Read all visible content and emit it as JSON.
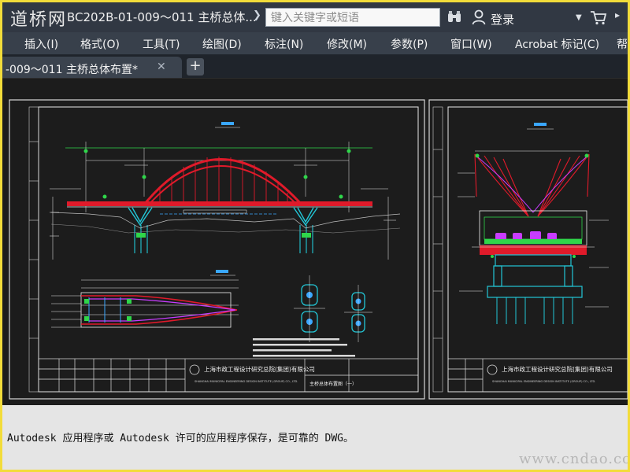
{
  "window": {
    "logo_text": "道桥网",
    "document_title": "BC202B-01-009～011 主桥总体...",
    "search_placeholder": "键入关键字或短语",
    "login_label": "登录"
  },
  "menu": {
    "items": [
      "插入(I)",
      "格式(O)",
      "工具(T)",
      "绘图(D)",
      "标注(N)",
      "修改(M)",
      "参数(P)",
      "窗口(W)",
      "Acrobat 标记(C)",
      "帮"
    ]
  },
  "tabs": {
    "active_label": "-009～011 主桥总体布置*",
    "close_symbol": "✕",
    "new_tab_symbol": "+"
  },
  "drawing": {
    "sheet1": {
      "company": "上海市政工程设计研究总院(集团)有限公司",
      "company_en": "SHANGHAI MUNICIPAL ENGINEERING DESIGN INSTITUTE (GROUP) CO., LTD.",
      "sheet_title": "主桥总体布置图（一）"
    },
    "sheet2": {
      "company": "上海市政工程设计研究总院(集团)有限公司",
      "company_en": "SHANGHAI MUNICIPAL ENGINEERING DESIGN INSTITUTE (GROUP) CO., LTD."
    }
  },
  "proxy": {
    "message": "Autodesk 应用程序或 Autodesk 许可的应用程序保存，是可靠的 DWG。",
    "watermark": "www.cndao.com"
  },
  "colors": {
    "accent_yellow": "#f2dc3a",
    "titlebar": "#313843",
    "canvas": "#1c1c1c",
    "arch_red": "#e01a2a",
    "pier_cyan": "#22c6d6",
    "dim_green": "#2fd64a",
    "proxy_bg": "#e5e5e5"
  },
  "icons": [
    "binoculars-icon",
    "user-icon",
    "cart-icon",
    "close-icon",
    "plus-icon",
    "chevron-right-icon",
    "caret-down-icon"
  ]
}
